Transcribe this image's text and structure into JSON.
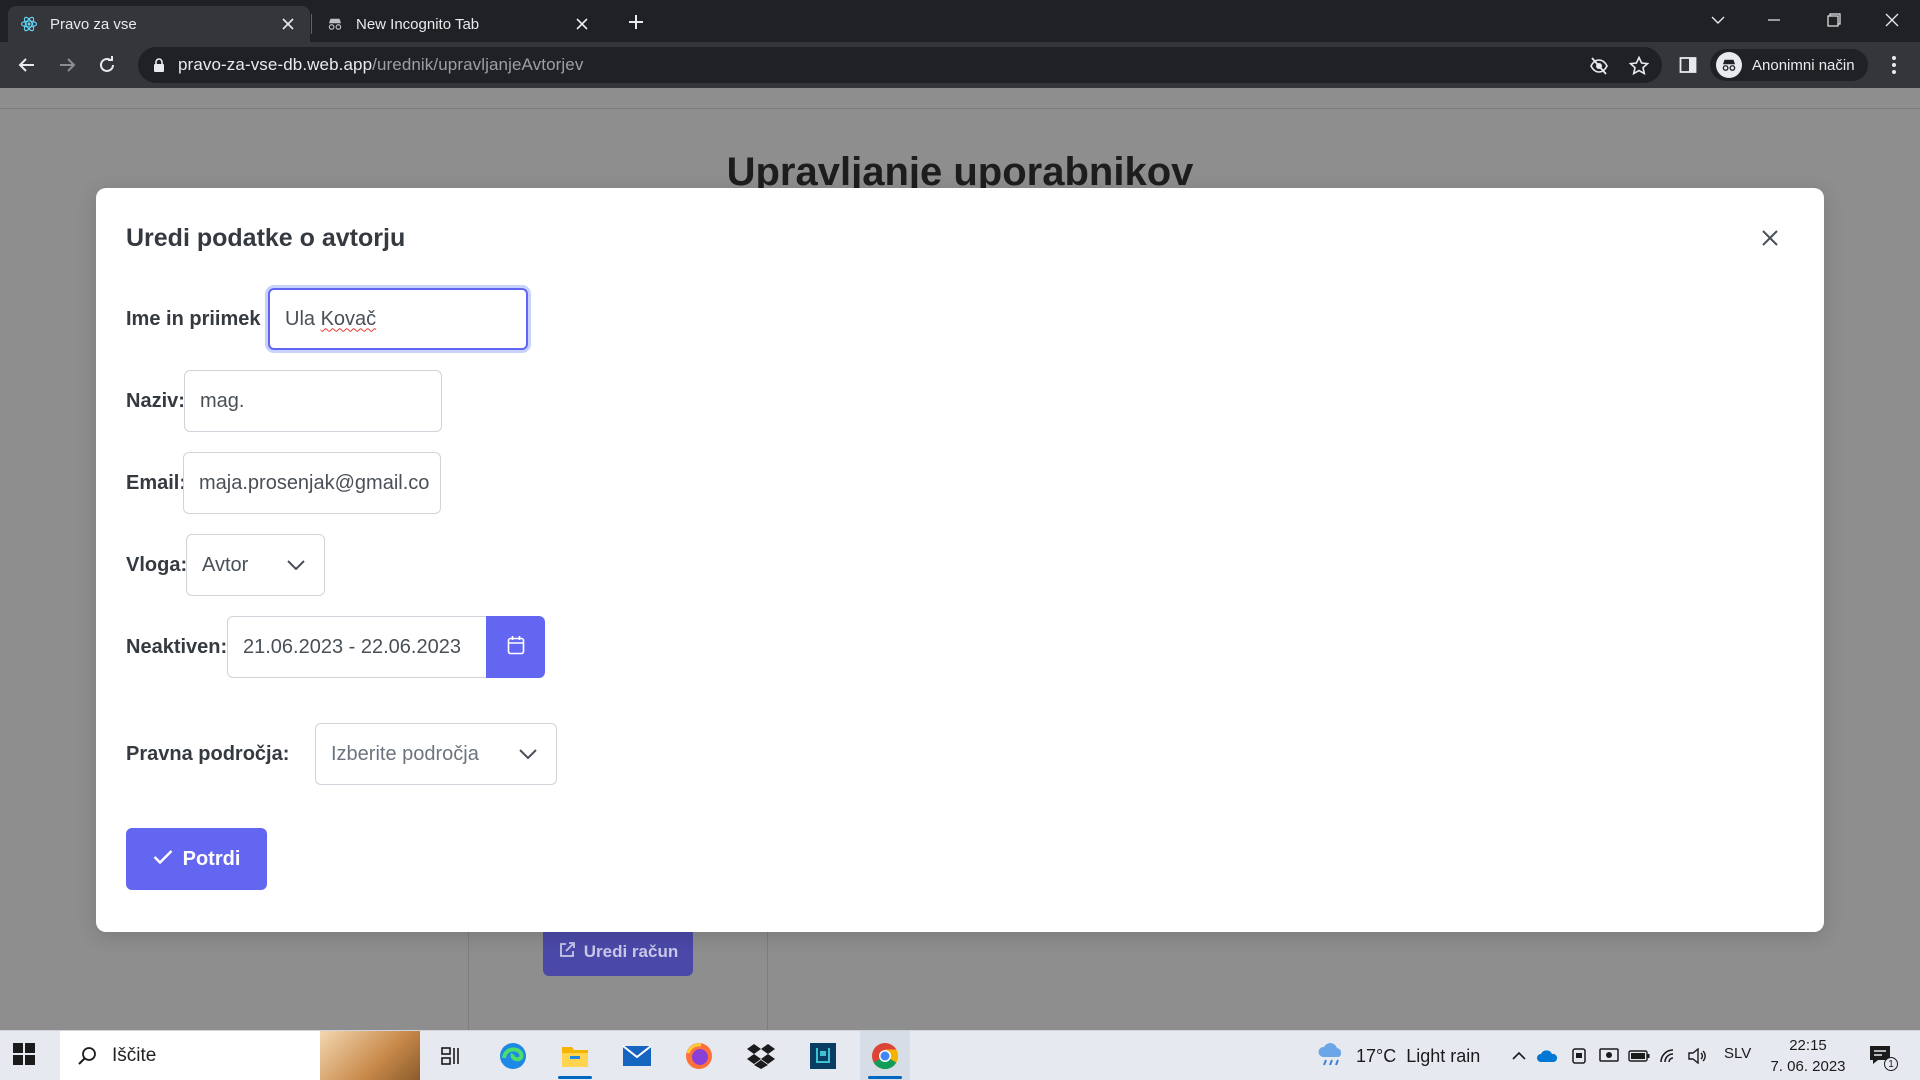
{
  "browser": {
    "tabs": [
      {
        "title": "Pravo za vse",
        "active": true
      },
      {
        "title": "New Incognito Tab",
        "active": false
      }
    ],
    "url_host": "pravo-za-vse-db.web.app",
    "url_path": "/urednik/upravljanjeAvtorjev",
    "profile_label": "Anonimni način"
  },
  "background_page": {
    "title": "Upravljanje uporabnikov",
    "edit_account_button": "Uredi račun"
  },
  "modal": {
    "title": "Uredi podatke o avtorju",
    "fields": {
      "name_label": "Ime in priimek",
      "name_first": "Ula",
      "name_last": "Kovač",
      "title_label": "Naziv:",
      "title_value": "mag.",
      "email_label": "Email:",
      "email_value": "maja.prosenjak@gmail.co",
      "role_label": "Vloga:",
      "role_value": "Avtor",
      "inactive_label": "Neaktiven:",
      "inactive_value": "21.06.2023 - 22.06.2023",
      "areas_label": "Pravna področja:",
      "areas_placeholder": "Izberite področja"
    },
    "confirm_button": "Potrdi"
  },
  "taskbar": {
    "search_label": "Iščite",
    "weather_temp": "17°C",
    "weather_text": "Light rain",
    "language": "SLV",
    "time": "22:15",
    "date": "7. 06. 2023",
    "notification_count": "1"
  },
  "colors": {
    "accent": "#6366f1",
    "overlay": "#8e8e8e",
    "chrome_dark": "#202124",
    "chrome_toolbar": "#35363a"
  }
}
